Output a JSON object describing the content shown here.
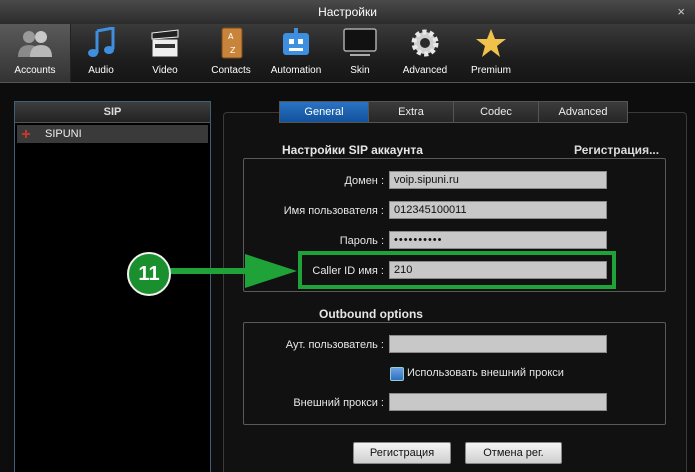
{
  "window": {
    "title": "Настройки",
    "close_glyph": "×"
  },
  "toolbar": {
    "items": [
      {
        "label": "Accounts",
        "icon": "users-icon"
      },
      {
        "label": "Audio",
        "icon": "music-note-icon"
      },
      {
        "label": "Video",
        "icon": "clapperboard-icon"
      },
      {
        "label": "Contacts",
        "icon": "address-book-icon"
      },
      {
        "label": "Automation",
        "icon": "robot-icon"
      },
      {
        "label": "Skin",
        "icon": "monitor-icon"
      },
      {
        "label": "Advanced",
        "icon": "gear-icon"
      },
      {
        "label": "Premium",
        "icon": "star-icon"
      }
    ],
    "active": "Accounts"
  },
  "sip_panel": {
    "title": "SIP",
    "accounts": [
      {
        "name": "SIPUNI",
        "status": "offline"
      }
    ]
  },
  "tabs": {
    "items": [
      "General",
      "Extra",
      "Codec",
      "Advanced"
    ],
    "active": "General"
  },
  "sip_settings": {
    "title": "Настройки SIP аккаунта",
    "registration_link": "Регистрация...",
    "domain_label": "Домен :",
    "domain_value": "voip.sipuni.ru",
    "username_label": "Имя пользователя :",
    "username_value": "012345100011",
    "password_label": "Пароль :",
    "password_value": "••••••••••",
    "callerid_label": "Caller ID имя :",
    "callerid_value": "210"
  },
  "outbound": {
    "title": "Outbound options",
    "auth_user_label": "Аут. пользователь :",
    "auth_user_value": "",
    "use_proxy_label": "Использовать внешний прокси",
    "use_proxy_checked": true,
    "proxy_label": "Внешний прокси :",
    "proxy_value": ""
  },
  "buttons": {
    "register": "Регистрация",
    "unregister": "Отмена рег."
  },
  "annotation": {
    "step_number": "11",
    "color": "#1fa339"
  }
}
